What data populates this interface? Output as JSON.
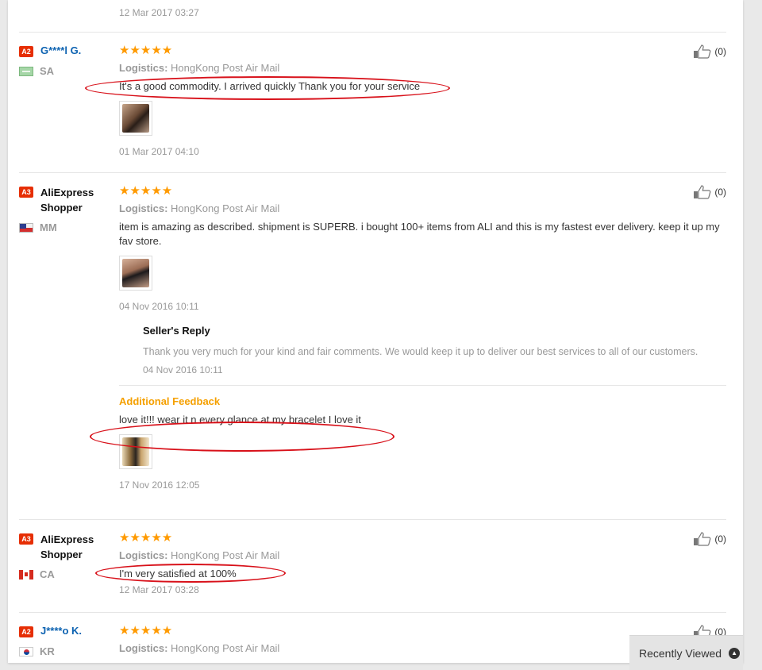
{
  "top_date": "12 Mar 2017 03:27",
  "reviews": [
    {
      "level": "A2",
      "user": "G****l G.",
      "country": "SA",
      "logistics_label": "Logistics:",
      "logistics": "HongKong Post Air Mail",
      "text": "It's a good commodity. I arrived quickly Thank you for your service",
      "date": "01 Mar 2017 04:10",
      "helpful_count": "(0)"
    },
    {
      "level": "A3",
      "user": "AliExpress Shopper",
      "country": "MM",
      "logistics_label": "Logistics:",
      "logistics": "HongKong Post Air Mail",
      "text": "item is amazing as described. shipment is SUPERB. i bought 100+ items from ALI and this is my fastest ever delivery. keep it up my fav store.",
      "date": "04 Nov 2016 10:11",
      "helpful_count": "(0)",
      "seller_reply": {
        "title": "Seller's Reply",
        "text": "Thank you very much for your kind and fair comments. We would keep it up to deliver our best services to all of our customers.",
        "date": "04 Nov 2016 10:11"
      },
      "additional": {
        "title": "Additional Feedback",
        "text": "love it!!! wear it n every glance at my bracelet I love it",
        "date": "17 Nov 2016 12:05"
      }
    },
    {
      "level": "A3",
      "user": "AliExpress Shopper",
      "country": "CA",
      "logistics_label": "Logistics:",
      "logistics": "HongKong Post Air Mail",
      "text": "I'm very satisfied at 100%",
      "date": "12 Mar 2017 03:28",
      "helpful_count": "(0)"
    },
    {
      "level": "A2",
      "user": "J****o K.",
      "country": "KR",
      "logistics_label": "Logistics:",
      "logistics": "HongKong Post Air Mail",
      "helpful_count": "(0)"
    }
  ],
  "stars": "★★★★★",
  "recently_viewed": "Recently Viewed",
  "colors": {
    "accent": "#e62e04",
    "star": "#ff9a00",
    "annotation": "#d8111a",
    "additional": "#f5a000"
  }
}
